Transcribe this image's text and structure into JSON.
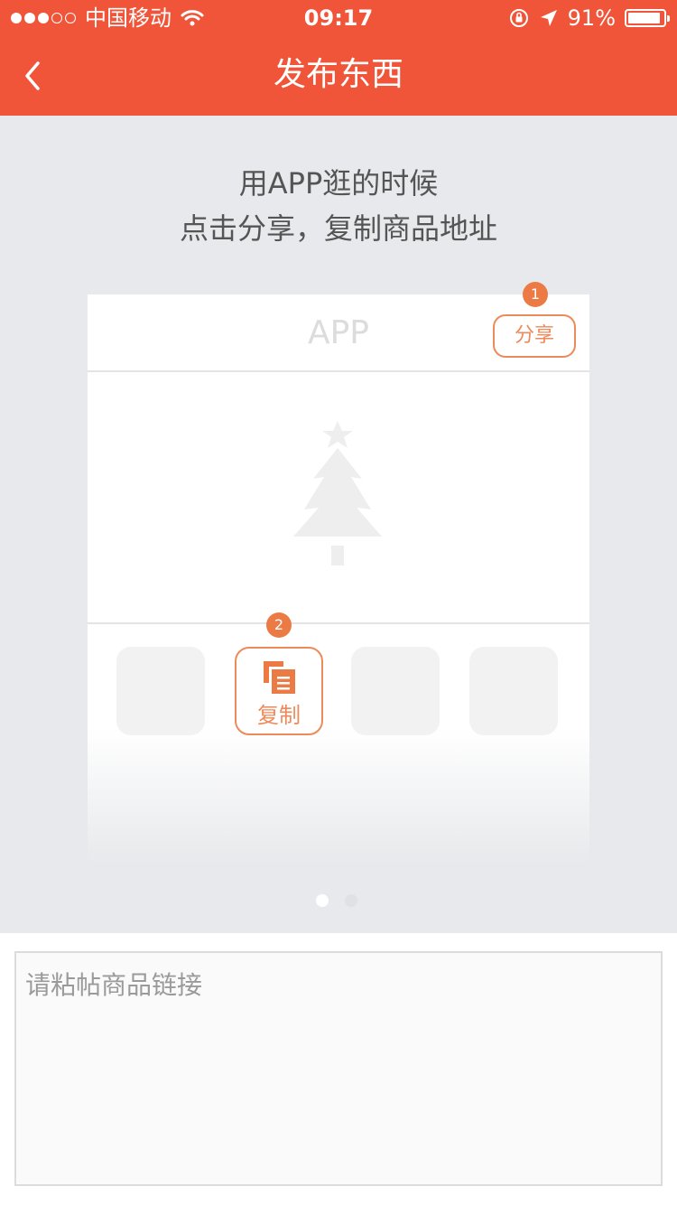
{
  "status_bar": {
    "carrier": "中国移动",
    "time": "09:17",
    "battery": "91%",
    "battery_level": 0.91,
    "signal_strength": 3,
    "signal_max": 5
  },
  "nav": {
    "title": "发布东西",
    "back_icon": "chevron-left-icon"
  },
  "tutorial": {
    "line1": "用APP逛的时候",
    "line2": "点击分享，复制商品地址",
    "mockup": {
      "app_label": "APP",
      "share_label": "分享",
      "badge_1": "1",
      "badge_2": "2",
      "copy_label": "复制",
      "illustration_icon": "christmas-tree-icon",
      "copy_icon": "copy-icon"
    },
    "pager": {
      "pages": 2,
      "current": 1
    }
  },
  "input": {
    "placeholder": "请粘帖商品链接",
    "value": ""
  },
  "colors": {
    "brand": "#f0553a",
    "accent": "#ed8a5a",
    "background": "#e8e9ec"
  }
}
